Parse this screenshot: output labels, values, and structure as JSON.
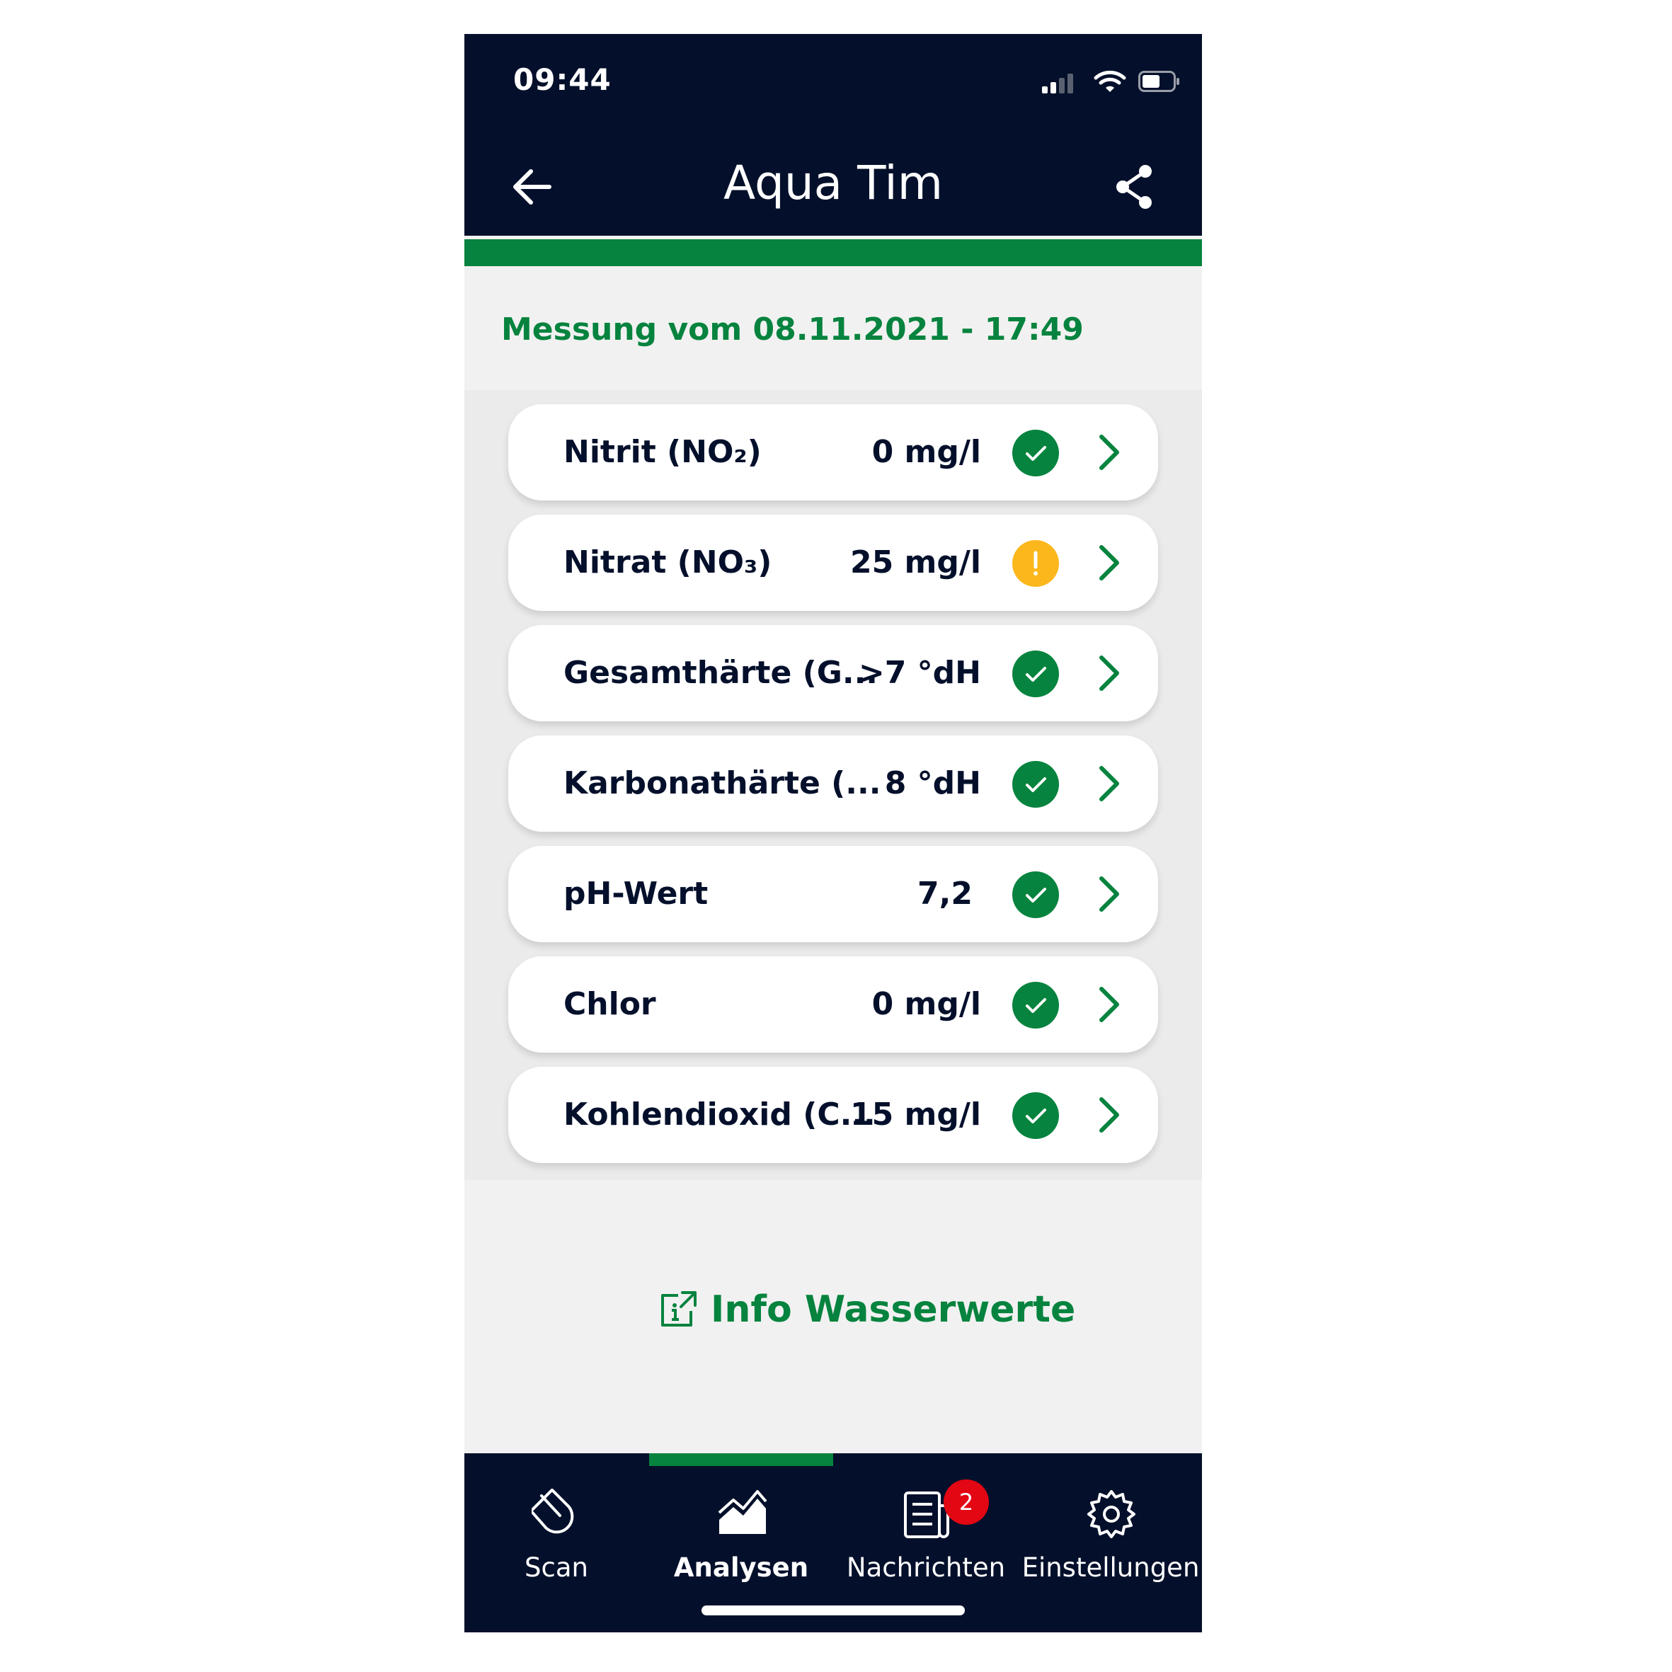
{
  "status_bar": {
    "time": "09:44"
  },
  "header": {
    "title": "Aqua Tim"
  },
  "measurement": {
    "date_label": "Messung vom 08.11.2021 - 17:49"
  },
  "rows": [
    {
      "label": "Nitrit (NO₂)",
      "value": "0 mg/l",
      "status": "ok"
    },
    {
      "label": "Nitrat (NO₃)",
      "value": "25 mg/l",
      "status": "warning"
    },
    {
      "label": "Gesamthärte (G...",
      "value": ">7 °dH",
      "status": "ok"
    },
    {
      "label": "Karbonathärte (...",
      "value": "8 °dH",
      "status": "ok"
    },
    {
      "label": "pH-Wert",
      "value": "7,2",
      "status": "ok"
    },
    {
      "label": "Chlor",
      "value": "0 mg/l",
      "status": "ok"
    },
    {
      "label": "Kohlendioxid (C...",
      "value": "15 mg/l",
      "status": "ok"
    }
  ],
  "info_link": {
    "label": "Info Wasserwerte"
  },
  "tabs": [
    {
      "label": "Scan",
      "icon": "drop-scan-icon",
      "active": false
    },
    {
      "label": "Analysen",
      "icon": "chart-area-icon",
      "active": true
    },
    {
      "label": "Nachrichten",
      "icon": "news-icon",
      "active": false,
      "badge": "2"
    },
    {
      "label": "Einstellungen",
      "icon": "gear-icon",
      "active": false
    }
  ],
  "colors": {
    "navy": "#04102b",
    "green": "#06833e",
    "warning": "#fbb71b",
    "badge": "#e30613",
    "background": "#f1f1f1"
  }
}
